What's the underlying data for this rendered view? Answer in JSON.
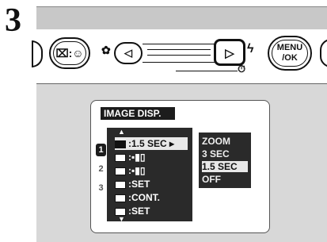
{
  "step_number": "3",
  "camera_controls": {
    "trash_face_glyph": "⌧:☺",
    "macro_glyph": "✿",
    "left_arrow": "◁",
    "right_arrow": "▷",
    "flash_glyph": "ϟ",
    "timer_glyph": "⏱",
    "menu_ok_line1": "MENU",
    "menu_ok_line2": "/OK"
  },
  "lcd": {
    "title": "IMAGE DISP.",
    "pages": [
      "1",
      "2",
      "3"
    ],
    "active_page": "1",
    "menu_items": [
      {
        "icon": "image-disp-icon",
        "value": ":1.5 SEC ▸"
      },
      {
        "icon": "quality-icon",
        "value": ":▪▮▯"
      },
      {
        "icon": "iso-icon",
        "value": ":▪▮▯"
      },
      {
        "icon": "sound-icon",
        "value": ":SET"
      },
      {
        "icon": "frame-no-icon",
        "value": ":CONT."
      },
      {
        "icon": "brightness-icon",
        "value": ":SET"
      }
    ],
    "submenu_options": [
      "ZOOM",
      "3  SEC",
      "1.5 SEC",
      "OFF"
    ],
    "selected_option": "1.5 SEC"
  }
}
